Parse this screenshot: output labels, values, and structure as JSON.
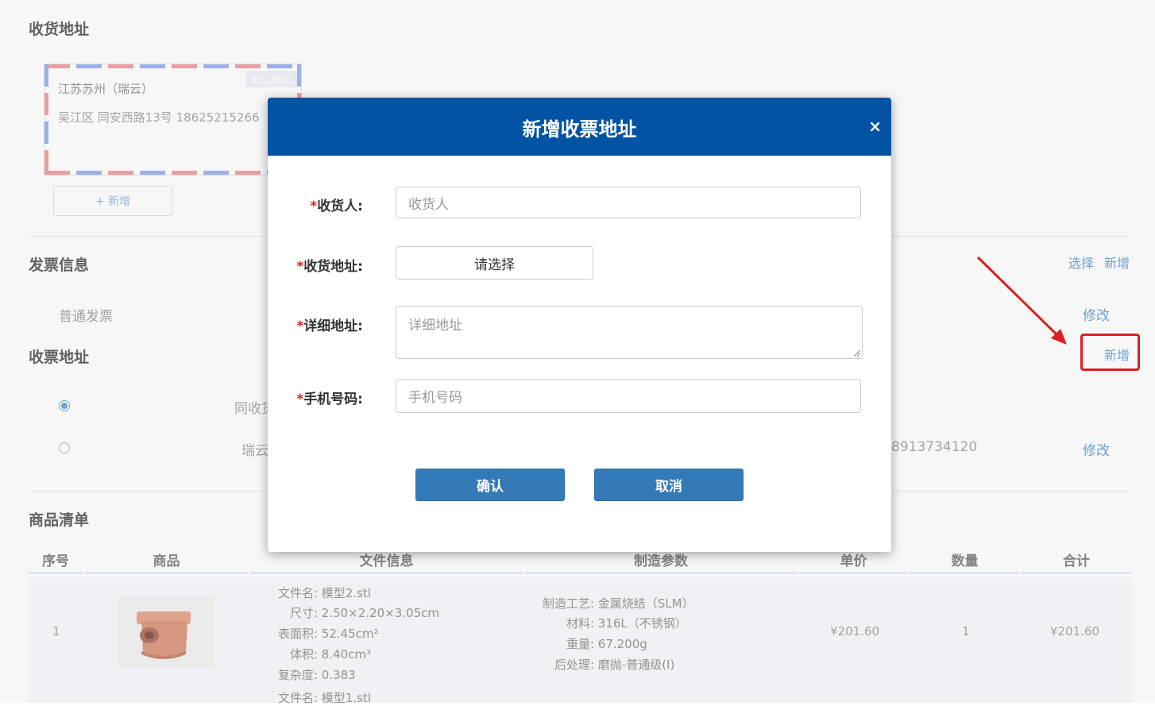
{
  "shipping": {
    "title": "收货地址",
    "card": {
      "default_tag": "默认地址",
      "city": "江苏苏州（瑞云）",
      "line": "吴江区 同安西路13号 18625215266"
    },
    "add_label": "+ 新增"
  },
  "invoice": {
    "title": "发票信息",
    "select_label": "选择",
    "add_label": "新增",
    "type": "普通发票",
    "edit_label": "修改"
  },
  "invoice_address": {
    "title": "收票地址",
    "add_label": "新增",
    "options": [
      {
        "label": "同收货",
        "selected": true
      },
      {
        "label": "瑞云",
        "phone": "8913734120",
        "edit_label": "修改",
        "selected": false
      }
    ]
  },
  "goods": {
    "title": "商品清单",
    "columns": [
      "序号",
      "商品",
      "文件信息",
      "制造参数",
      "单价",
      "数量",
      "合计"
    ],
    "rows": [
      {
        "index": "1",
        "file_info": [
          {
            "k": "文件名:",
            "v": "模型2.stl"
          },
          {
            "k": "尺寸:",
            "v": "2.50×2.20×3.05cm"
          },
          {
            "k": "表面积:",
            "v": "52.45cm²"
          },
          {
            "k": "体积:",
            "v": "8.40cm³"
          },
          {
            "k": "复杂度:",
            "v": "0.383"
          }
        ],
        "params": [
          {
            "k": "制造工艺:",
            "v": "金属烧结（SLM）"
          },
          {
            "k": "材料:",
            "v": "316L（不锈钢）"
          },
          {
            "k": "重量:",
            "v": "67.200g"
          },
          {
            "k": "后处理:",
            "v": "磨抛-普通级(I)"
          }
        ],
        "price": "¥201.60",
        "qty": "1",
        "total": "¥201.60"
      }
    ],
    "next_file_label": "文件名:",
    "next_file_value": "模型1.stl"
  },
  "modal": {
    "title": "新增收票地址",
    "close": "×",
    "fields": {
      "receiver": {
        "label": "收货人:",
        "placeholder": "收货人"
      },
      "address": {
        "label": "收货地址:",
        "value": "请选择"
      },
      "detail": {
        "label": "详细地址:",
        "placeholder": "详细地址"
      },
      "phone": {
        "label": "手机号码:",
        "placeholder": "手机号码"
      }
    },
    "required_mark": "*",
    "confirm": "确认",
    "cancel": "取消"
  },
  "colors": {
    "modal_header": "#0353a4",
    "primary_button": "#337ab7",
    "link": "#6fa8dc",
    "annotation": "#e52020"
  }
}
